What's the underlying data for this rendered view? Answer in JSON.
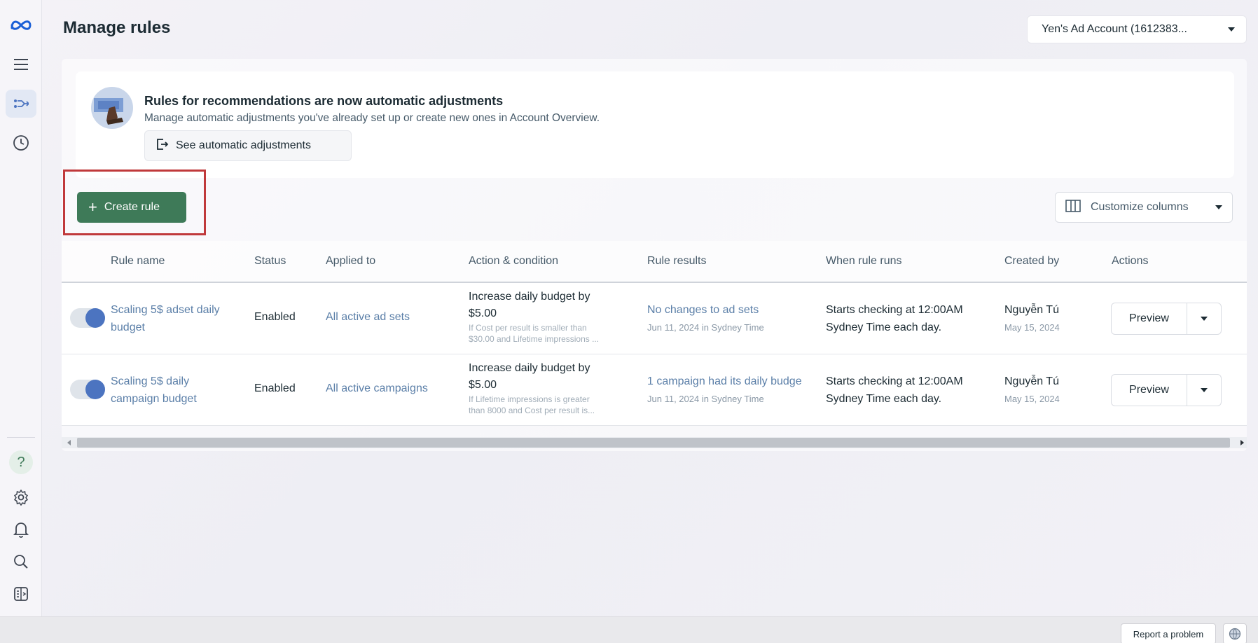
{
  "header": {
    "title": "Manage rules",
    "account_label": "Yen's Ad Account (1612383..."
  },
  "sidebar": {
    "top_icons": [
      "meta-logo-icon",
      "menu-icon",
      "automated-rules-icon",
      "history-clock-icon"
    ],
    "bottom_icons": [
      "help-icon",
      "settings-gear-icon",
      "notifications-bell-icon",
      "search-icon",
      "panel-toggle-icon"
    ]
  },
  "banner": {
    "title": "Rules for recommendations are now automatic adjustments",
    "subtitle": "Manage automatic adjustments you've already set up or create new ones in Account Overview.",
    "button_label": "See automatic adjustments"
  },
  "toolbar": {
    "create_label": "Create rule",
    "customize_label": "Customize columns"
  },
  "table": {
    "columns": [
      "Rule name",
      "Status",
      "Applied to",
      "Action & condition",
      "Rule results",
      "When rule runs",
      "Created by",
      "Actions"
    ],
    "rows": [
      {
        "name_line1": "Scaling 5$ adset daily",
        "name_line2": "budget",
        "status": "Enabled",
        "applied_to": "All active ad sets",
        "action_line1": "Increase daily budget by",
        "action_line2": "$5.00",
        "condition_line1": "If Cost per result is smaller than",
        "condition_line2": "$30.00 and Lifetime impressions ...",
        "result": "No changes to ad sets",
        "result_date": "Jun 11, 2024 in Sydney Time",
        "runs_line1": "Starts checking at 12:00AM",
        "runs_line2": "Sydney Time each day.",
        "creator": "Nguyễn Tú",
        "created_date": "May 15, 2024",
        "action_button": "Preview"
      },
      {
        "name_line1": "Scaling 5$ daily",
        "name_line2": "campaign budget",
        "status": "Enabled",
        "applied_to": "All active campaigns",
        "action_line1": "Increase daily budget by",
        "action_line2": "$5.00",
        "condition_line1": "If Lifetime impressions is greater",
        "condition_line2": "than 8000 and Cost per result is...",
        "result": "1 campaign had its daily budge",
        "result_date": "Jun 11, 2024 in Sydney Time",
        "runs_line1": "Starts checking at 12:00AM",
        "runs_line2": "Sydney Time each day.",
        "creator": "Nguyễn Tú",
        "created_date": "May 15, 2024",
        "action_button": "Preview"
      }
    ]
  },
  "footer": {
    "report_label": "Report a problem"
  },
  "colors": {
    "primary_green": "#3e7a58",
    "link_blue": "#5b7fa8",
    "toggle_blue": "#4c74c0",
    "highlight_red": "#c0393b"
  }
}
